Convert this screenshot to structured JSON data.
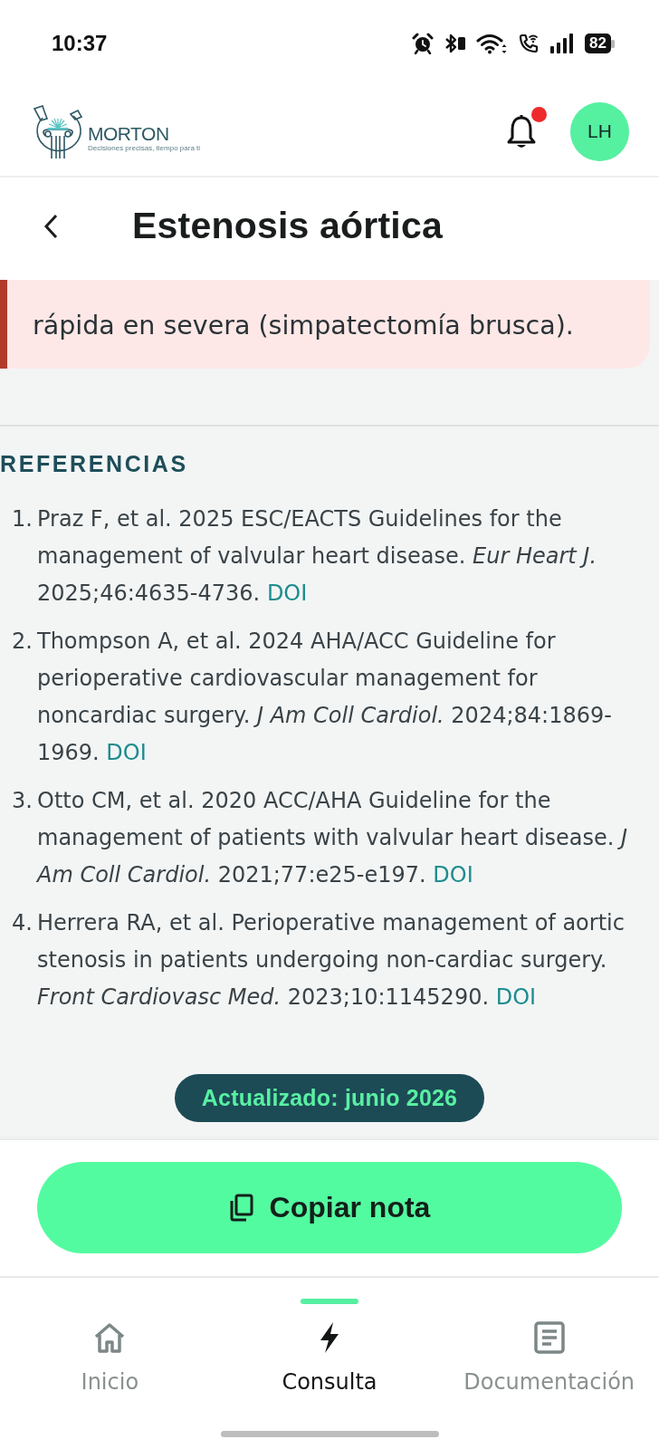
{
  "status_bar": {
    "time": "10:37",
    "battery": "82"
  },
  "header": {
    "logo": {
      "name": "MORTON",
      "tagline": "Decisiones precisas, tiempo para ti"
    },
    "notifications": {
      "unread": true
    },
    "avatar": {
      "initials": "LH"
    }
  },
  "title_bar": {
    "title": "Estenosis aórtica"
  },
  "alert_card": {
    "text": "rápida en severa (simpatectomía brusca)."
  },
  "references": {
    "heading": "REFERENCIAS",
    "items": [
      {
        "number": "1.",
        "text": "Praz F, et al. 2025 ESC/EACTS Guidelines for the management of valvular heart disease. *Eur Heart J.* 2025;46:4635-4736.",
        "link": "DOI"
      },
      {
        "number": "2.",
        "text": "Thompson A, et al. 2024 AHA/ACC Guideline for perioperative cardiovascular management for noncardiac surgery. *J Am Coll Cardiol.* 2024;84:1869-1969.",
        "link": "DOI"
      },
      {
        "number": "3.",
        "text": "Otto CM, et al. 2020 ACC/AHA Guideline for the management of patients with valvular heart disease. *J Am Coll Cardiol.* 2021;77:e25-e197.",
        "link": "DOI"
      },
      {
        "number": "4.",
        "text": "Herrera RA, et al. Perioperative management of aortic stenosis in patients undergoing non-cardiac surgery. *Front Cardiovasc Med.* 2023;10:1145290.",
        "link": "DOI"
      }
    ]
  },
  "updated_badge": "Actualizado: junio 2026",
  "copy_button": {
    "label": "Copiar nota"
  },
  "bottom_nav": [
    {
      "label": "Inicio",
      "selected": false
    },
    {
      "label": "Consulta",
      "selected": true
    },
    {
      "label": "Documentación",
      "selected": false
    }
  ]
}
